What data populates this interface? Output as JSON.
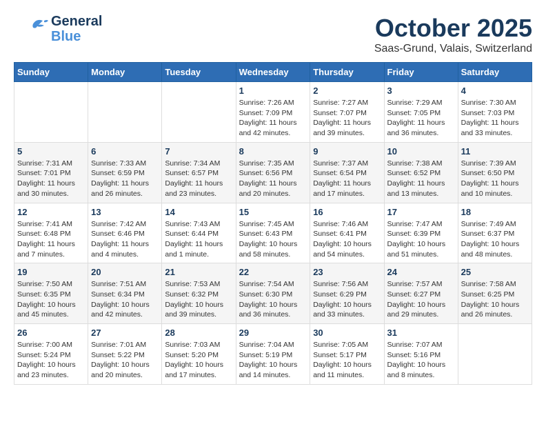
{
  "header": {
    "logo_general": "General",
    "logo_blue": "Blue",
    "month": "October 2025",
    "location": "Saas-Grund, Valais, Switzerland"
  },
  "weekdays": [
    "Sunday",
    "Monday",
    "Tuesday",
    "Wednesday",
    "Thursday",
    "Friday",
    "Saturday"
  ],
  "weeks": [
    [
      {
        "day": "",
        "info": ""
      },
      {
        "day": "",
        "info": ""
      },
      {
        "day": "",
        "info": ""
      },
      {
        "day": "1",
        "info": "Sunrise: 7:26 AM\nSunset: 7:09 PM\nDaylight: 11 hours and 42 minutes."
      },
      {
        "day": "2",
        "info": "Sunrise: 7:27 AM\nSunset: 7:07 PM\nDaylight: 11 hours and 39 minutes."
      },
      {
        "day": "3",
        "info": "Sunrise: 7:29 AM\nSunset: 7:05 PM\nDaylight: 11 hours and 36 minutes."
      },
      {
        "day": "4",
        "info": "Sunrise: 7:30 AM\nSunset: 7:03 PM\nDaylight: 11 hours and 33 minutes."
      }
    ],
    [
      {
        "day": "5",
        "info": "Sunrise: 7:31 AM\nSunset: 7:01 PM\nDaylight: 11 hours and 30 minutes."
      },
      {
        "day": "6",
        "info": "Sunrise: 7:33 AM\nSunset: 6:59 PM\nDaylight: 11 hours and 26 minutes."
      },
      {
        "day": "7",
        "info": "Sunrise: 7:34 AM\nSunset: 6:57 PM\nDaylight: 11 hours and 23 minutes."
      },
      {
        "day": "8",
        "info": "Sunrise: 7:35 AM\nSunset: 6:56 PM\nDaylight: 11 hours and 20 minutes."
      },
      {
        "day": "9",
        "info": "Sunrise: 7:37 AM\nSunset: 6:54 PM\nDaylight: 11 hours and 17 minutes."
      },
      {
        "day": "10",
        "info": "Sunrise: 7:38 AM\nSunset: 6:52 PM\nDaylight: 11 hours and 13 minutes."
      },
      {
        "day": "11",
        "info": "Sunrise: 7:39 AM\nSunset: 6:50 PM\nDaylight: 11 hours and 10 minutes."
      }
    ],
    [
      {
        "day": "12",
        "info": "Sunrise: 7:41 AM\nSunset: 6:48 PM\nDaylight: 11 hours and 7 minutes."
      },
      {
        "day": "13",
        "info": "Sunrise: 7:42 AM\nSunset: 6:46 PM\nDaylight: 11 hours and 4 minutes."
      },
      {
        "day": "14",
        "info": "Sunrise: 7:43 AM\nSunset: 6:44 PM\nDaylight: 11 hours and 1 minute."
      },
      {
        "day": "15",
        "info": "Sunrise: 7:45 AM\nSunset: 6:43 PM\nDaylight: 10 hours and 58 minutes."
      },
      {
        "day": "16",
        "info": "Sunrise: 7:46 AM\nSunset: 6:41 PM\nDaylight: 10 hours and 54 minutes."
      },
      {
        "day": "17",
        "info": "Sunrise: 7:47 AM\nSunset: 6:39 PM\nDaylight: 10 hours and 51 minutes."
      },
      {
        "day": "18",
        "info": "Sunrise: 7:49 AM\nSunset: 6:37 PM\nDaylight: 10 hours and 48 minutes."
      }
    ],
    [
      {
        "day": "19",
        "info": "Sunrise: 7:50 AM\nSunset: 6:35 PM\nDaylight: 10 hours and 45 minutes."
      },
      {
        "day": "20",
        "info": "Sunrise: 7:51 AM\nSunset: 6:34 PM\nDaylight: 10 hours and 42 minutes."
      },
      {
        "day": "21",
        "info": "Sunrise: 7:53 AM\nSunset: 6:32 PM\nDaylight: 10 hours and 39 minutes."
      },
      {
        "day": "22",
        "info": "Sunrise: 7:54 AM\nSunset: 6:30 PM\nDaylight: 10 hours and 36 minutes."
      },
      {
        "day": "23",
        "info": "Sunrise: 7:56 AM\nSunset: 6:29 PM\nDaylight: 10 hours and 33 minutes."
      },
      {
        "day": "24",
        "info": "Sunrise: 7:57 AM\nSunset: 6:27 PM\nDaylight: 10 hours and 29 minutes."
      },
      {
        "day": "25",
        "info": "Sunrise: 7:58 AM\nSunset: 6:25 PM\nDaylight: 10 hours and 26 minutes."
      }
    ],
    [
      {
        "day": "26",
        "info": "Sunrise: 7:00 AM\nSunset: 5:24 PM\nDaylight: 10 hours and 23 minutes."
      },
      {
        "day": "27",
        "info": "Sunrise: 7:01 AM\nSunset: 5:22 PM\nDaylight: 10 hours and 20 minutes."
      },
      {
        "day": "28",
        "info": "Sunrise: 7:03 AM\nSunset: 5:20 PM\nDaylight: 10 hours and 17 minutes."
      },
      {
        "day": "29",
        "info": "Sunrise: 7:04 AM\nSunset: 5:19 PM\nDaylight: 10 hours and 14 minutes."
      },
      {
        "day": "30",
        "info": "Sunrise: 7:05 AM\nSunset: 5:17 PM\nDaylight: 10 hours and 11 minutes."
      },
      {
        "day": "31",
        "info": "Sunrise: 7:07 AM\nSunset: 5:16 PM\nDaylight: 10 hours and 8 minutes."
      },
      {
        "day": "",
        "info": ""
      }
    ]
  ]
}
